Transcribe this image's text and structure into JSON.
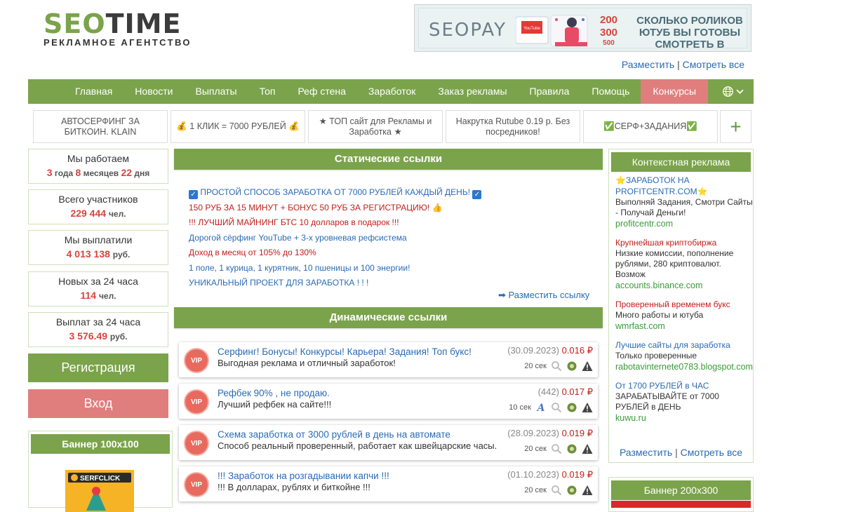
{
  "logo": {
    "seo": "SEO",
    "time": "TIME",
    "subtitle": "РЕКЛАМНОЕ АГЕНТСТВО"
  },
  "top_banner": {
    "brand": "SEOPAY",
    "nums": [
      "200",
      "300",
      "500"
    ],
    "text": "СКОЛЬКО РОЛИКОВ ЮТУБ ВЫ ГОТОВЫ СМОТРЕТЬ В СУТКИ?",
    "pic_text": "YouTube"
  },
  "top_links": {
    "place": "Разместить",
    "sep": "|",
    "view_all": "Смотреть все"
  },
  "nav": {
    "items": [
      "Главная",
      "Новости",
      "Выплаты",
      "Топ",
      "Реф стена",
      "Заработок",
      "Заказ рекламы",
      "Правила",
      "Помощь",
      "Конкурсы"
    ],
    "lang_icon": "globe-icon",
    "caret": "⌄"
  },
  "ads_row": [
    "АВТОСЕРФИНГ ЗА БИТКОИН. KLAIN",
    "💰 1 КЛИК = 7000 РУБЛЕЙ 💰",
    "★ ТОП сайт для Рекламы и Заработка ★",
    "Накрутка Rutube 0.19 р. Без посредников!",
    "✅СЕРФ+ЗАДАНИЯ✅"
  ],
  "ads_plus": "+",
  "stats": [
    {
      "title": "Мы работаем",
      "parts": [
        [
          "3",
          " года "
        ],
        [
          "8",
          " месяцев "
        ],
        [
          "22",
          " дня"
        ]
      ]
    },
    {
      "title": "Всего участников",
      "value": "229 444",
      "unit": "чел."
    },
    {
      "title": "Мы выплатили",
      "value": "4 013 138",
      "unit": "руб."
    },
    {
      "title": "Новых за 24 часа",
      "value": "114",
      "unit": "чел."
    },
    {
      "title": "Выплат за 24 часа",
      "value": "3 576.49",
      "unit": "руб."
    }
  ],
  "buttons": {
    "register": "Регистрация",
    "login": "Вход"
  },
  "banner100": {
    "title": "Баннер 100x100",
    "img_text": "SERFCLICK"
  },
  "static": {
    "title": "Статические ссылки",
    "links": [
      {
        "text": "ПРОСТОЙ СПОСОБ ЗАРАБОТКА ОТ 7000 РУБЛЕЙ КАЖДЫЙ ДЕНЬ!",
        "color": "blue",
        "check": true
      },
      {
        "text": "150 РУБ ЗА 15 МИНУТ + БОНУС 50 РУБ ЗА РЕГИСТРАЦИЮ! 👍",
        "color": "red"
      },
      {
        "text": "!!! ЛУЧШИЙ МАЙНИНГ БТС 10 долларов в подарок !!!",
        "color": "red"
      },
      {
        "text": "Дорогой сёрфинг YouTube + 3-х уровневая рефсистема",
        "color": "blue"
      },
      {
        "text": "Доход в месяц от 105% до 130%",
        "color": "red"
      },
      {
        "text": "1 поле, 1 курица, 1 курятник, 10 пшеницы и 100 энергии!",
        "color": "blue"
      },
      {
        "text": "УНИКАЛЬНЫЙ ПРОЕКТ ДЛЯ ЗАРАБОТКА ! ! !",
        "color": "blue"
      }
    ],
    "place_link": "➡ Разместить ссылку",
    "check_mark": "✓"
  },
  "dynamic": {
    "title": "Динамические ссылки",
    "vip": "VIP",
    "items": [
      {
        "title": "Серфинг! Бонусы! Конкурсы! Карьера! Задания! Топ букс!",
        "desc": "Выгодная реклама и отличный заработок!",
        "meta": "(30.09.2023)",
        "price": "0.016 ₽",
        "time": "20 сек",
        "a_icon": false
      },
      {
        "title": "Рефбек 90% , не продаю.",
        "desc": "Лучший рефбек на сайте!!!",
        "meta": "(442)",
        "price": "0.017 ₽",
        "time": "10 сек",
        "a_icon": true
      },
      {
        "title": "Схема заработка от 3000 рублей в день на автомате",
        "desc": "Способ реальный проверенный, работает как швейцарские часы.",
        "meta": "(28.09.2023)",
        "price": "0.019 ₽",
        "time": "20 сек",
        "a_icon": false
      },
      {
        "title": "!!! Заработок на розгадывании капчи !!!",
        "desc": "!!! В долларах, рублях и биткойне !!!",
        "meta": "(01.10.2023)",
        "price": "0.019 ₽",
        "time": "20 сек",
        "a_icon": false
      }
    ]
  },
  "context": {
    "title": "Контекстная реклама",
    "items": [
      {
        "title": "⭐ЗАРАБОТОК НА PROFITCENTR.COM⭐",
        "desc": "Выполняй Задания, Смотри Сайты - Получай Деньги!",
        "url": "profitcentr.com",
        "title_color": "blue"
      },
      {
        "title": "Крупнейшая криптобиржа",
        "desc": "Низкие комиссии, пополнение рублями, 280 криптовалют. Возмож",
        "url": "accounts.binance.com",
        "title_color": "red"
      },
      {
        "title": "Проверенный временем букс",
        "desc": "Много работы и ютуба",
        "url": "wmrfast.com",
        "title_color": "red"
      },
      {
        "title": "Лучшие сайты для заработка",
        "desc": "Только проверенные",
        "url": "rabotavinternete0783.blogspot.com",
        "title_color": "blue"
      },
      {
        "title": "От 1700 РУБЛЕЙ в ЧАС",
        "desc": "ЗАРАБАТЫВАЙТЕ от 7000 РУБЛЕЙ в ДЕНЬ",
        "url": "kuwu.ru",
        "title_color": "blue"
      }
    ],
    "footer": {
      "place": "Разместить",
      "sep": "|",
      "view_all": "Смотреть все"
    }
  },
  "banner200": {
    "title": "Баннер 200x300"
  },
  "colors": {
    "green": "#7ba34b",
    "red_accent": "#e07e7e",
    "link_blue": "#2a6bb5",
    "red_text": "#c0201c",
    "url_green": "#3a9b3a"
  }
}
